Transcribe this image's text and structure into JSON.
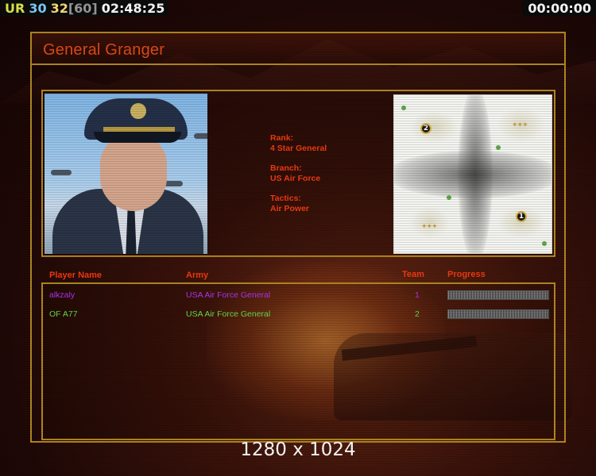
{
  "hud": {
    "prefix": "UR",
    "value_a": "30",
    "value_b": "32",
    "value_c": "[60]",
    "elapsed": "02:48:25",
    "timer": "00:00:00"
  },
  "title": "General Granger",
  "general": {
    "rank_label": "Rank:",
    "rank_value": "4 Star General",
    "branch_label": "Branch:",
    "branch_value": "US Air Force",
    "tactics_label": "Tactics:",
    "tactics_value": "Air Power"
  },
  "minimap": {
    "markers": [
      "2",
      "1"
    ]
  },
  "player_table": {
    "columns": [
      "Player Name",
      "Army",
      "Team",
      "Progress"
    ],
    "rows": [
      {
        "name": "alkzaly",
        "army": "USA Air Force General",
        "team": "1",
        "progress": 1.0,
        "color": "#b236f0"
      },
      {
        "name": "OF A77",
        "army": "USA Air Force General",
        "team": "2",
        "progress": 1.0,
        "color": "#5fe04a"
      }
    ]
  },
  "resolution_text": "1280 x 1024",
  "colors": {
    "accent_text": "#f23a12",
    "frame": "#b48a20",
    "player1": "#b236f0",
    "player2": "#5fe04a"
  }
}
